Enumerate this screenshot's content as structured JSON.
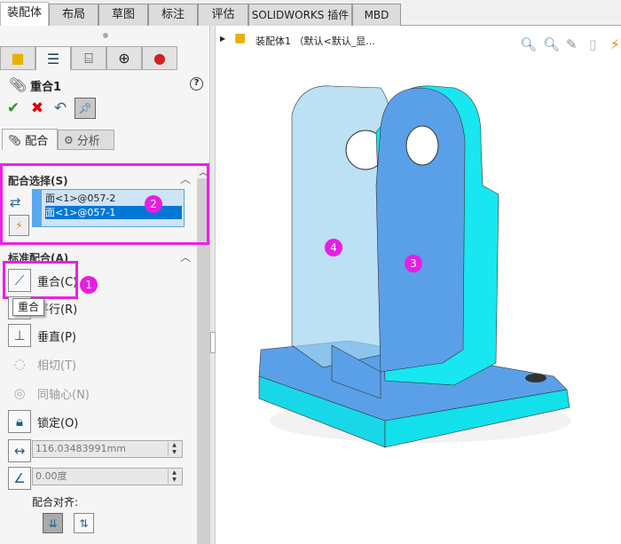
{
  "tabs": [
    {
      "label": "装配体"
    },
    {
      "label": "布局"
    },
    {
      "label": "草图"
    },
    {
      "label": "标注"
    },
    {
      "label": "评估"
    },
    {
      "label": "SOLIDWORKS 插件"
    },
    {
      "label": "MBD"
    }
  ],
  "panel": {
    "title": "重合1",
    "subtabs": [
      "配合",
      "分析"
    ],
    "selection_group": {
      "title": "配合选择(S)",
      "items": [
        "面<1>@057-2",
        "面<1>@057-1"
      ],
      "badge": "2"
    },
    "standard_group": {
      "title": "标准配合(A)",
      "badge": "1",
      "tooltip": "重合",
      "items": [
        {
          "label": "重合(C)",
          "enabled": true
        },
        {
          "label": "平行(R)",
          "enabled": true
        },
        {
          "label": "垂直(P)",
          "enabled": true
        },
        {
          "label": "相切(T)",
          "enabled": false
        },
        {
          "label": "同轴心(N)",
          "enabled": false
        },
        {
          "label": "锁定(O)",
          "enabled": true
        }
      ],
      "distance_value": "116.03483991mm",
      "angle_value": "0.00度",
      "alignment_label": "配合对齐:"
    }
  },
  "viewport": {
    "tree_label": "装配体1 （默认<默认_显...",
    "badges": [
      "3",
      "4"
    ]
  },
  "colors": {
    "accent": "#ee1ee6",
    "selection": "#0078d7",
    "part_face": "#5aa0e8",
    "part_cyan": "#18e6f0"
  }
}
